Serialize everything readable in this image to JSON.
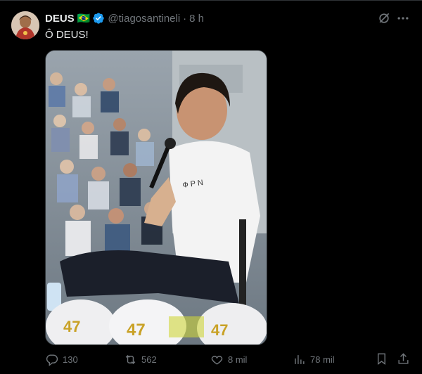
{
  "post": {
    "display_name": "DEUS",
    "flag_emoji": "🇧🇷",
    "handle": "@tiagosantineli",
    "separator": "·",
    "time": "8 h",
    "text": "Ô DEUS!",
    "image_caps_number": "47"
  },
  "actions": {
    "replies": "130",
    "reposts": "562",
    "likes": "8 mil",
    "views": "78 mil"
  },
  "icons": {
    "avatar": "avatar-image",
    "verified": "verified-badge-icon",
    "grok": "grok-icon",
    "more": "more-icon",
    "reply": "reply-icon",
    "repost": "repost-icon",
    "like": "heart-icon",
    "views": "views-chart-icon",
    "bookmark": "bookmark-icon",
    "share": "share-icon"
  },
  "colors": {
    "background": "#000000",
    "text": "#e7e9ea",
    "muted": "#71767b",
    "verified": "#1d9bf0",
    "cap_number": "#c9a227"
  }
}
